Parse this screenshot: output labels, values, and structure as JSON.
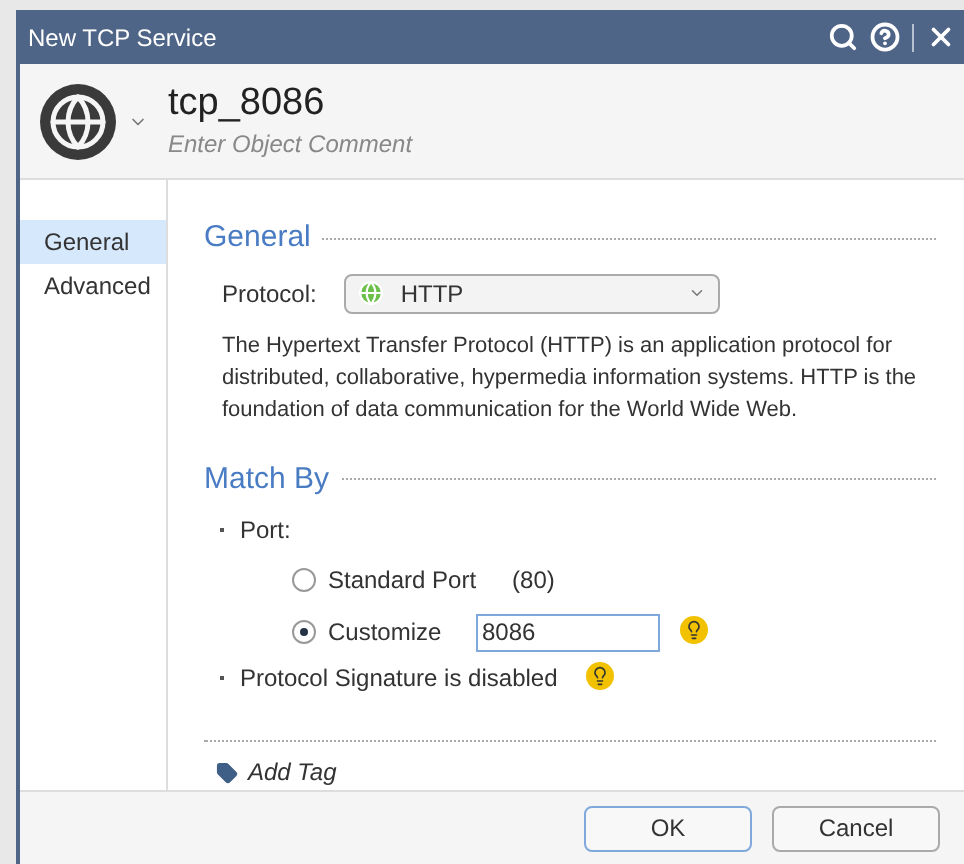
{
  "window": {
    "title": "New TCP Service"
  },
  "header": {
    "name": "tcp_8086",
    "comment_placeholder": "Enter Object Comment"
  },
  "sidebar": {
    "items": [
      {
        "label": "General",
        "selected": true
      },
      {
        "label": "Advanced",
        "selected": false
      }
    ]
  },
  "general": {
    "heading": "General",
    "protocol_label": "Protocol:",
    "protocol_value": "HTTP",
    "description": "The Hypertext Transfer Protocol (HTTP) is an application protocol for distributed, collaborative, hypermedia information systems. HTTP is the foundation of data communication for the World Wide Web."
  },
  "match_by": {
    "heading": "Match By",
    "port_label": "Port:",
    "options": [
      {
        "label": "Standard Port",
        "note": "(80)",
        "selected": false
      },
      {
        "label": "Customize",
        "value": "8086",
        "selected": true
      }
    ],
    "signature_text": "Protocol Signature is disabled"
  },
  "add_tag": "Add Tag",
  "buttons": [
    {
      "label": "OK",
      "kind": "primary"
    },
    {
      "label": "Cancel",
      "kind": "secondary"
    }
  ]
}
